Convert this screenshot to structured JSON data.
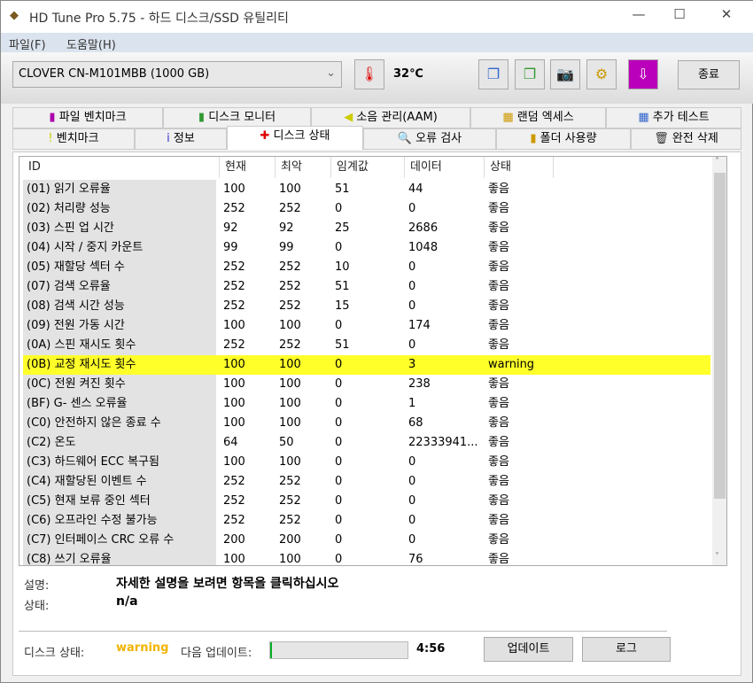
{
  "window": {
    "title": "HD Tune Pro 5.75 - 하드 디스크/SSD 유틸리티",
    "minimize": "—",
    "maximize": "☐",
    "close": "✕"
  },
  "menu": [
    "파일(F)",
    "도움말(H)"
  ],
  "toolbar": {
    "drive": "CLOVER  CN-M101MBB (1000 GB)",
    "temperature": "32℃",
    "exit_label": "종료"
  },
  "tabs_top": [
    "파일 벤치마크",
    "디스크 모니터",
    "소음 관리(AAM)",
    "랜덤 엑세스",
    "추가 테스트"
  ],
  "tabs_bottom": [
    "벤치마크",
    "정보",
    "디스크 상태",
    "오류 검사",
    "폴더 사용량",
    "완전 삭제"
  ],
  "active_tab": "디스크 상태",
  "table": {
    "columns": [
      "ID",
      "현재",
      "최악",
      "임계값",
      "데이터",
      "상태"
    ],
    "rows": [
      [
        "(01) 읽기 오류율",
        "100",
        "100",
        "51",
        "44",
        "좋음"
      ],
      [
        "(02) 처리량 성능",
        "252",
        "252",
        "0",
        "0",
        "좋음"
      ],
      [
        "(03) 스핀 업 시간",
        "92",
        "92",
        "25",
        "2686",
        "좋음"
      ],
      [
        "(04) 시작 / 중지 카운트",
        "99",
        "99",
        "0",
        "1048",
        "좋음"
      ],
      [
        "(05) 재할당 섹터 수",
        "252",
        "252",
        "10",
        "0",
        "좋음"
      ],
      [
        "(07) 검색 오류율",
        "252",
        "252",
        "51",
        "0",
        "좋음"
      ],
      [
        "(08) 검색 시간 성능",
        "252",
        "252",
        "15",
        "0",
        "좋음"
      ],
      [
        "(09) 전원 가동 시간",
        "100",
        "100",
        "0",
        "174",
        "좋음"
      ],
      [
        "(0A) 스핀 재시도 횟수",
        "252",
        "252",
        "51",
        "0",
        "좋음"
      ],
      [
        "(0B) 교정 재시도 횟수",
        "100",
        "100",
        "0",
        "3",
        "warning"
      ],
      [
        "(0C) 전원 켜진 횟수",
        "100",
        "100",
        "0",
        "238",
        "좋음"
      ],
      [
        "(BF) G- 센스 오류율",
        "100",
        "100",
        "0",
        "1",
        "좋음"
      ],
      [
        "(C0) 안전하지 않은 종료 수",
        "100",
        "100",
        "0",
        "68",
        "좋음"
      ],
      [
        "(C2) 온도",
        "64",
        "50",
        "0",
        "22333941...",
        "좋음"
      ],
      [
        "(C3) 하드웨어 ECC 복구됨",
        "100",
        "100",
        "0",
        "0",
        "좋음"
      ],
      [
        "(C4) 재할당된 이벤트 수",
        "252",
        "252",
        "0",
        "0",
        "좋음"
      ],
      [
        "(C5) 현재 보류 중인 섹터",
        "252",
        "252",
        "0",
        "0",
        "좋음"
      ],
      [
        "(C6) 오프라인 수정 불가능",
        "252",
        "252",
        "0",
        "0",
        "좋음"
      ],
      [
        "(C7) 인터페이스 CRC 오류 수",
        "200",
        "200",
        "0",
        "0",
        "좋음"
      ],
      [
        "(C8) 쓰기 오류율",
        "100",
        "100",
        "0",
        "76",
        "좋음"
      ]
    ]
  },
  "details": {
    "desc_label": "설명:",
    "desc_value": "자세한 설명을 보려면 항목을 클릭하십시오",
    "status_label": "상태:",
    "status_value": "n/a"
  },
  "footer": {
    "disk_status_label": "디스크 상태:",
    "disk_status": "warning",
    "next_update_label": "다음 업데이트:",
    "progress_percent": 1,
    "countdown": "4:56",
    "update_button": "업데이트",
    "log_button": "로그"
  },
  "colors": {
    "warning_row": "#ffff2a",
    "warning_text": "#f0b400",
    "progress": "#06b025"
  }
}
